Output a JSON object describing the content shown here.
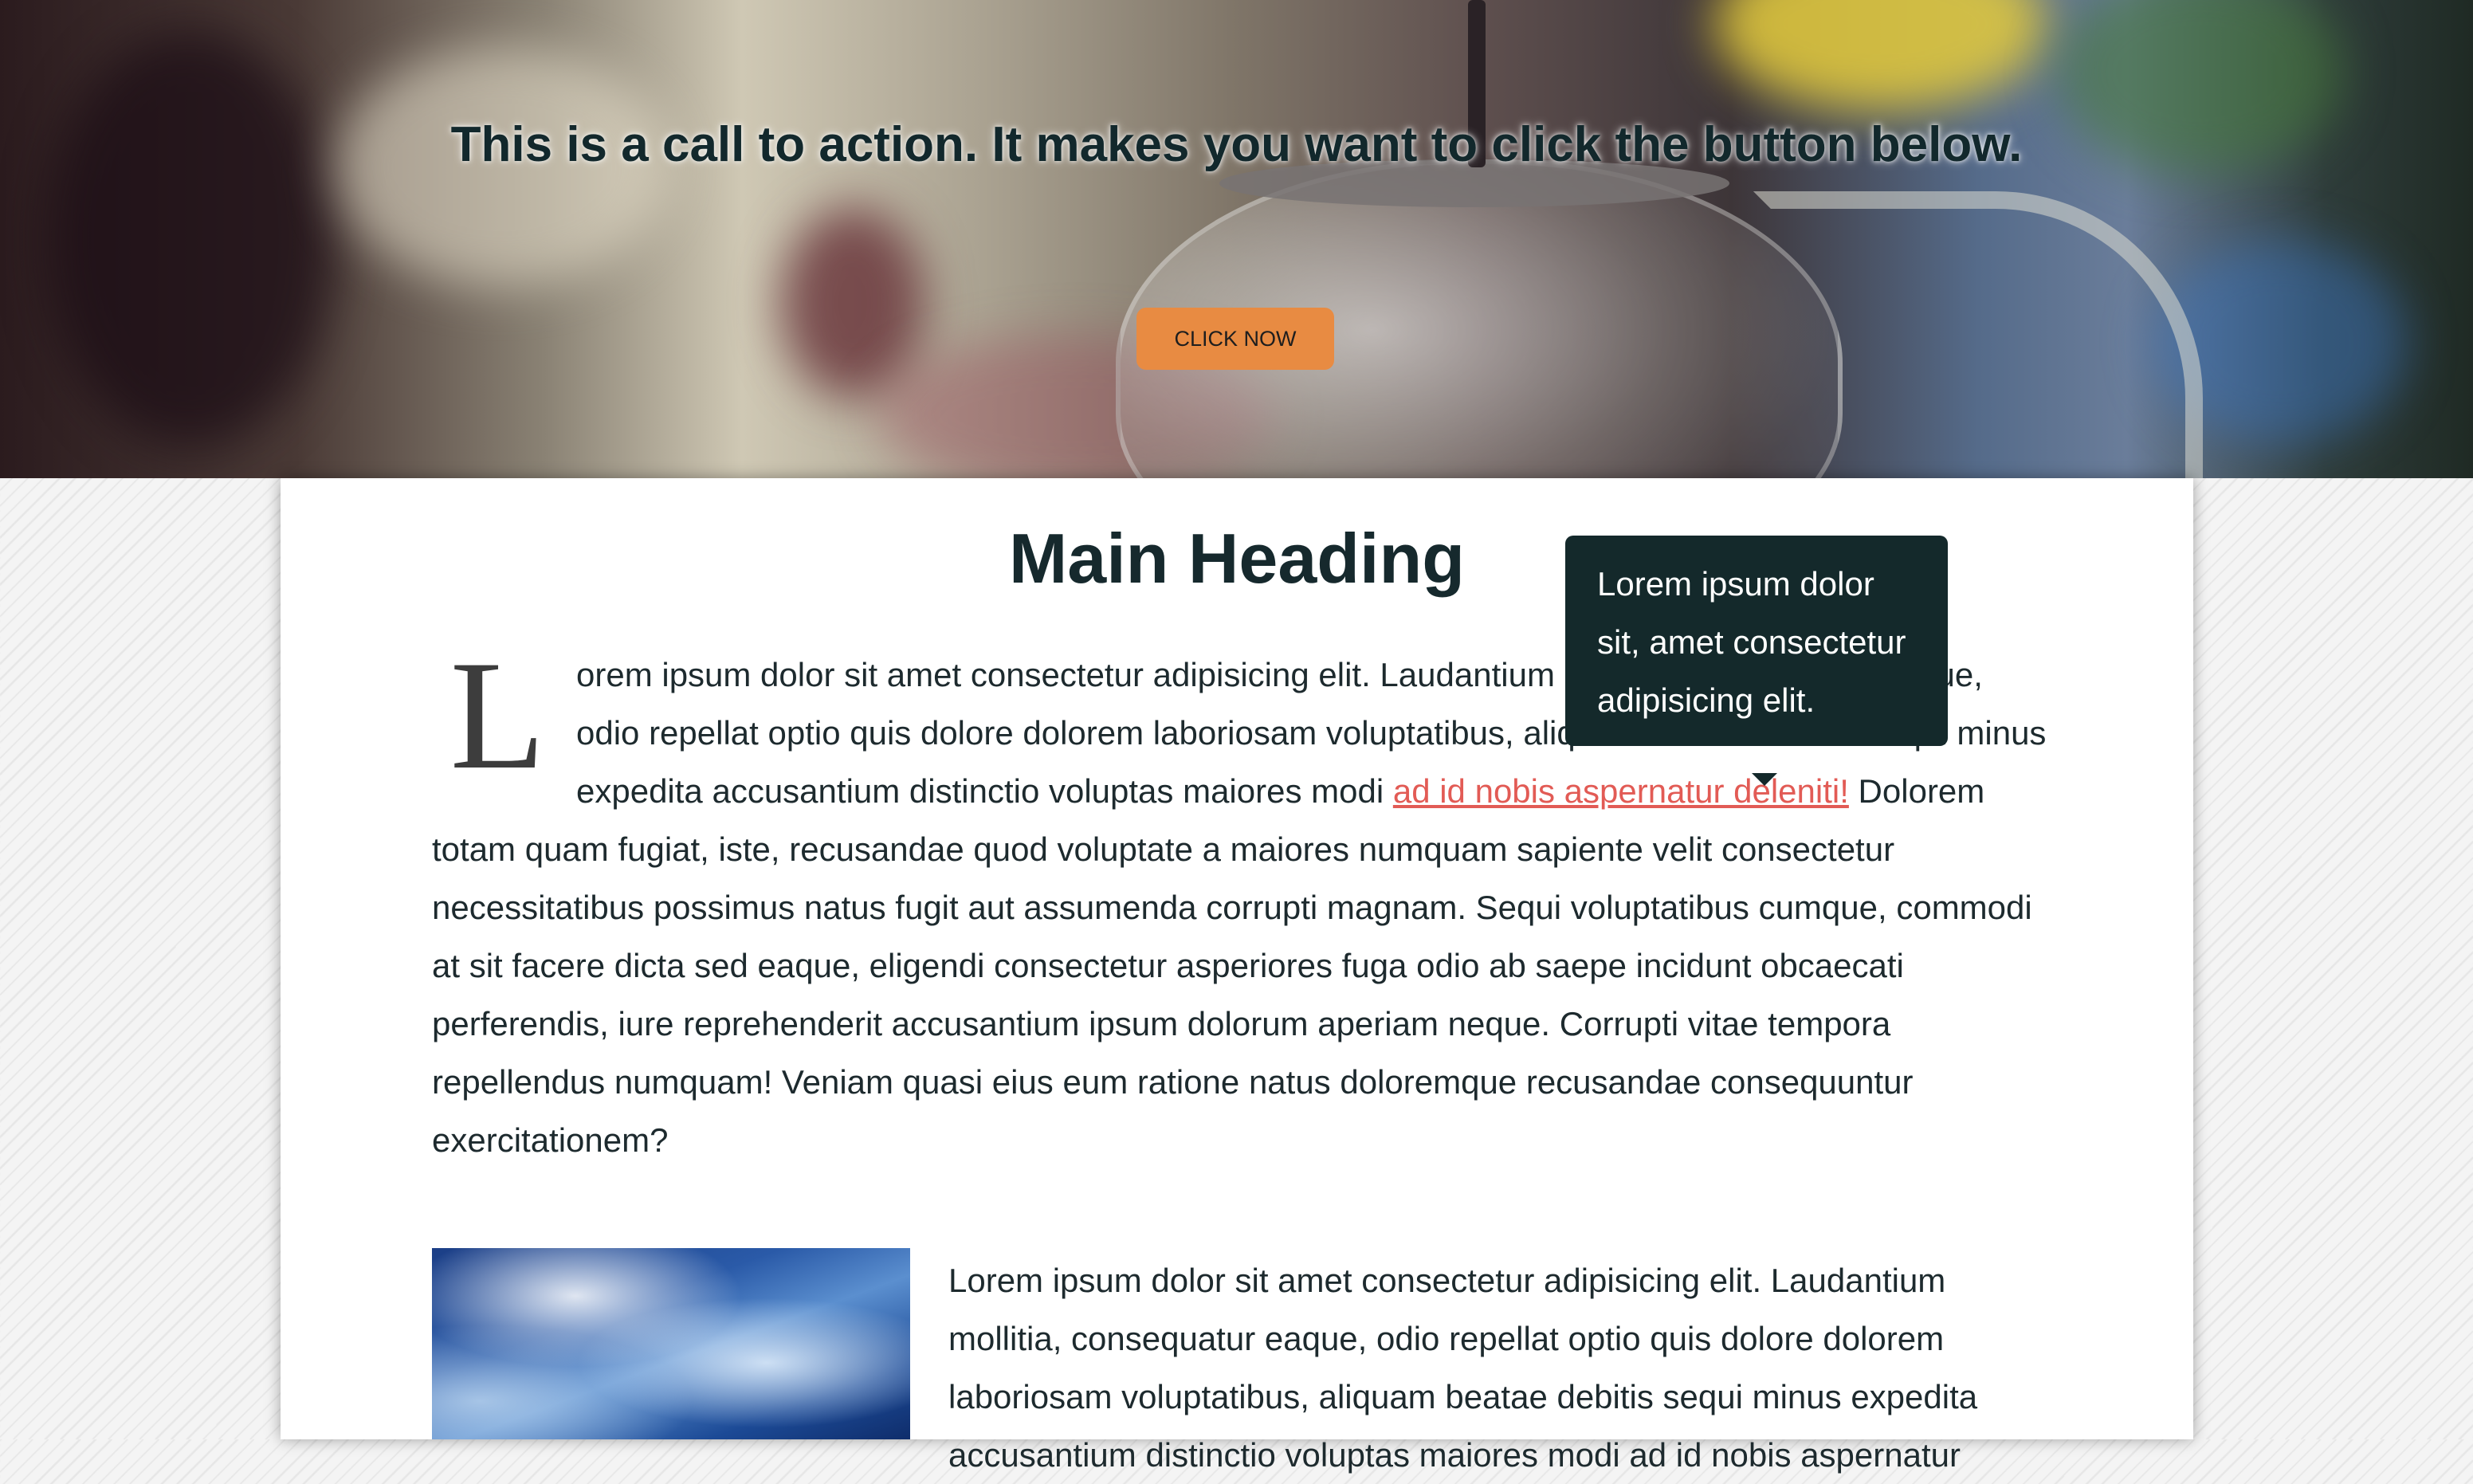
{
  "hero": {
    "call_to_action": "This is a call to action. It makes you want to click the button below.",
    "button_label": "CLICK NOW"
  },
  "article": {
    "heading": "Main Heading",
    "dropcap": "L",
    "paragraph1_text": "orem ipsum dolor sit amet consectetur adipisicing elit. Laudantium mollitia, consequatur eaque, odio repellat optio quis dolore dolorem laboriosam voluptatibus, aliquam beatae debitis sequi minus expedita accusantium distinctio voluptas maiores modi ",
    "paragraph1_link": "ad id nobis aspernatur deleniti!",
    "paragraph1_rest": " Dolorem totam quam fugiat, iste, recusandae quod voluptate a maiores numquam sapiente velit consectetur necessitatibus possimus natus fugit aut assumenda corrupti magnam. Sequi voluptatibus cumque, commodi at sit facere dicta sed eaque, eligendi consectetur asperiores fuga odio ab saepe incidunt obcaecati perferendis, iure reprehenderit accusantium ipsum dolorum aperiam neque. Corrupti vitae tempora repellendus numquam! Veniam quasi eius eum ratione natus doloremque recusandae consequuntur exercitationem?",
    "tooltip": "Lorem ipsum dolor sit, amet consectetur adipisicing elit.",
    "paragraph2": "Lorem ipsum dolor sit amet consectetur adipisicing elit. Laudantium mollitia, consequatur eaque, odio repellat optio quis dolore dolorem laboriosam voluptatibus, aliquam beatae debitis sequi minus expedita accusantium distinctio voluptas maiores modi ad id nobis aspernatur"
  },
  "colors": {
    "accent_button": "#e88b42",
    "link": "#e25b55",
    "tooltip_bg": "#14292b",
    "heading": "#16292d"
  }
}
